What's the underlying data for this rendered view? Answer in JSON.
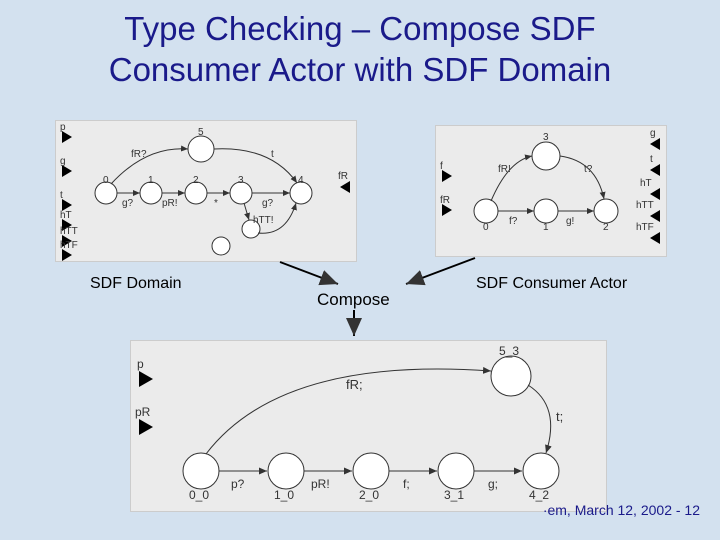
{
  "title_line1": "Type Checking – Compose SDF",
  "title_line2": "Consumer Actor with SDF Domain",
  "labels": {
    "left": "SDF Domain",
    "compose": "Compose",
    "right": "SDF Consumer Actor"
  },
  "footer": "·em, March 12, 2002 - 12",
  "diagrams": {
    "left": {
      "ports": [
        "p",
        "g",
        "t",
        "hT",
        "hTT",
        "hTF",
        "fR"
      ],
      "nodes": [
        {
          "id": "n0",
          "label": "0"
        },
        {
          "id": "n1",
          "label": "1"
        },
        {
          "id": "n2",
          "label": "2"
        },
        {
          "id": "n3",
          "label": "3"
        },
        {
          "id": "n4",
          "label": "4"
        },
        {
          "id": "n5",
          "label": "5"
        },
        {
          "id": "n6a",
          "label": ""
        },
        {
          "id": "n6b",
          "label": ""
        }
      ],
      "edges": [
        {
          "from": "n0",
          "to": "n1",
          "label": "g?"
        },
        {
          "from": "n1",
          "to": "n2",
          "label": "pR!"
        },
        {
          "from": "n2",
          "to": "n3",
          "label": "*"
        },
        {
          "from": "n3",
          "to": "n4",
          "label": "g?"
        },
        {
          "from": "n0",
          "to": "n5",
          "label": "fR?"
        },
        {
          "from": "n5",
          "to": "n4",
          "label": "t"
        },
        {
          "from": "n3",
          "to": "n6a",
          "label": "hTT!"
        },
        {
          "from": "n6a",
          "to": "n4",
          "label": ""
        }
      ]
    },
    "right": {
      "ports": [
        "f",
        "fR",
        "g",
        "t",
        "hT",
        "hTT",
        "hTF"
      ],
      "nodes": [
        {
          "id": "r0",
          "label": "0"
        },
        {
          "id": "r1",
          "label": "1"
        },
        {
          "id": "r2",
          "label": "2"
        },
        {
          "id": "r3",
          "label": "3"
        }
      ],
      "edges": [
        {
          "from": "r0",
          "to": "r3",
          "label": "fR!"
        },
        {
          "from": "r0",
          "to": "r1",
          "label": "f?"
        },
        {
          "from": "r1",
          "to": "r2",
          "label": "g!"
        },
        {
          "from": "r3",
          "to": "r2",
          "label": "t?"
        }
      ]
    },
    "bottom": {
      "ports": [
        "p",
        "pR"
      ],
      "nodes": [
        {
          "id": "b00",
          "label": "0_0"
        },
        {
          "id": "b10",
          "label": "1_0"
        },
        {
          "id": "b20",
          "label": "2_0"
        },
        {
          "id": "b31",
          "label": "3_1"
        },
        {
          "id": "b42",
          "label": "4_2"
        },
        {
          "id": "b53",
          "label": "5_3"
        }
      ],
      "edges": [
        {
          "from": "b00",
          "to": "b10",
          "label": "p?"
        },
        {
          "from": "b10",
          "to": "b20",
          "label": "pR!"
        },
        {
          "from": "b20",
          "to": "b31",
          "label": "f;"
        },
        {
          "from": "b31",
          "to": "b42",
          "label": "g;"
        },
        {
          "from": "b00",
          "to": "b53",
          "label": "fR;"
        },
        {
          "from": "b53",
          "to": "b42",
          "label": "t;"
        }
      ]
    }
  }
}
